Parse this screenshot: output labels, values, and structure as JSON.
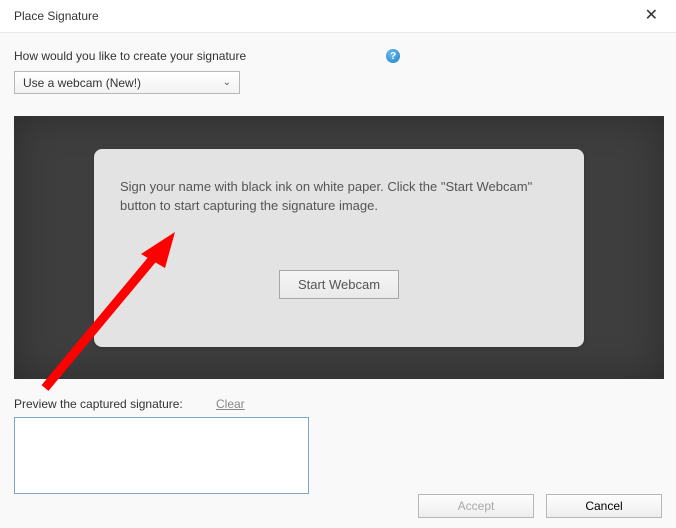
{
  "titlebar": {
    "title": "Place Signature",
    "close": "✕"
  },
  "question": {
    "label": "How would you like to create your signature",
    "help": "?"
  },
  "dropdown": {
    "selected": "Use a webcam (New!)",
    "chevron": "⌄"
  },
  "panel": {
    "text": "Sign your name with black ink on white paper. Click the \"Start Webcam\" button to start capturing the signature image.",
    "start_label": "Start Webcam"
  },
  "preview": {
    "label": "Preview the captured signature:",
    "clear": "Clear"
  },
  "footer": {
    "accept": "Accept",
    "cancel": "Cancel"
  }
}
